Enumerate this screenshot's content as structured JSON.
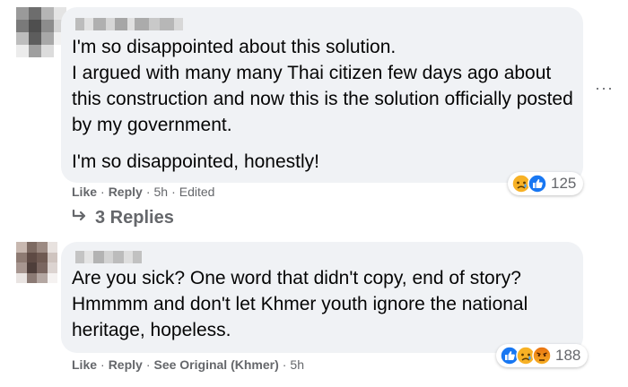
{
  "comments": [
    {
      "paragraphs": [
        "I'm so disappointed about this solution.\nI argued with many many Thai citizen few days ago about this construction and now this is the solution officially posted by my government.",
        "I'm so disappointed, honestly!"
      ],
      "actions": {
        "like": "Like",
        "reply": "Reply",
        "time": "5h",
        "edited": "Edited"
      },
      "reaction_count": "125",
      "reactions": [
        "sad",
        "like"
      ],
      "replies_label": "3 Replies"
    },
    {
      "paragraphs": [
        "Are you sick? One word that didn't copy, end of story? Hmmmm and don't let Khmer youth ignore the national heritage, hopeless."
      ],
      "actions": {
        "like": "Like",
        "reply": "Reply",
        "see_original": "See Original (Khmer)",
        "time": "5h"
      },
      "reaction_count": "188",
      "reactions": [
        "like",
        "sad",
        "haha"
      ]
    }
  ],
  "more_options_icon": "ellipsis-icon",
  "reply_arrow_icon": "reply-arrow-icon",
  "colors": {
    "bubble": "#f0f2f5",
    "secondary_text": "#65676b",
    "like_blue": "#1877f2",
    "emoji_yellow": "#f7b125",
    "angry_red": "#e9710f"
  }
}
